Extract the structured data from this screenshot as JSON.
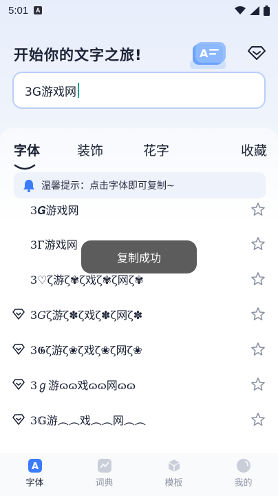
{
  "status_bar": {
    "time": "5:01",
    "app_badge": "A"
  },
  "header": {
    "title": "开始你的文字之旅!"
  },
  "input": {
    "value": "3G游戏网"
  },
  "tabs": [
    {
      "label": "字体",
      "active": true
    },
    {
      "label": "装饰",
      "active": false
    },
    {
      "label": "花字",
      "active": false
    },
    {
      "label": "收藏",
      "active": false
    }
  ],
  "tip": {
    "text": "温馨提示：点击字体即可复制~"
  },
  "results": [
    {
      "text": "3𝑮游戏网",
      "vip": false
    },
    {
      "text": "3Г游戏网",
      "vip": false
    },
    {
      "text": "3♡ζ游ζ✾ζ戏ζ✾ζ网ζ✾",
      "vip": false
    },
    {
      "text": "3𝐺ζ游ζ✽ζ戏ζ✽ζ网ζ✽",
      "vip": true
    },
    {
      "text": "3𝕲ζ游ζ❀ζ戏ζ❀ζ网ζ❀",
      "vip": true
    },
    {
      "text": "3ℊ游ɷɷ戏ɷɷ网ɷɷ",
      "vip": true
    },
    {
      "text": "3𝔾游︵︵戏︵︵网︵︵",
      "vip": true
    }
  ],
  "toast": {
    "text": "复制成功"
  },
  "bottom_nav": [
    {
      "label": "字体",
      "icon": "font-icon",
      "active": true
    },
    {
      "label": "词典",
      "icon": "dictionary-icon",
      "active": false
    },
    {
      "label": "模板",
      "icon": "template-icon",
      "active": false
    },
    {
      "label": "我的",
      "icon": "profile-icon",
      "active": false
    }
  ],
  "colors": {
    "accent": "#3b7cff",
    "border": "#b9cffa",
    "caret": "#1aa38a"
  }
}
